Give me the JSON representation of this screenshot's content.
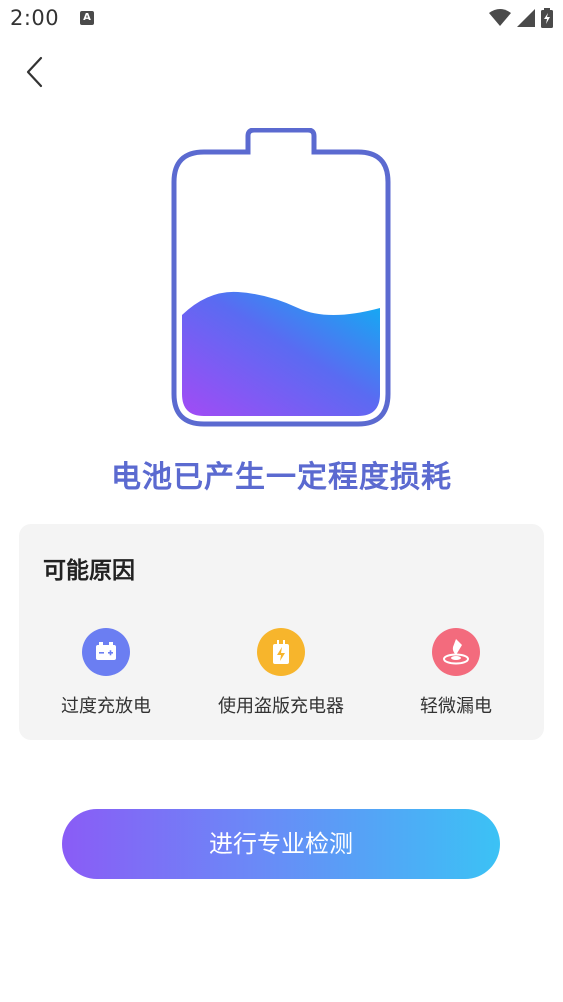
{
  "status_bar": {
    "time": "2:00",
    "notification_icon": "A",
    "icons": [
      "wifi-icon",
      "signal-icon",
      "battery-charging-icon"
    ]
  },
  "nav": {
    "back_icon": "chevron-left-icon"
  },
  "battery": {
    "fill_level": 0.42,
    "wave_colors": [
      "#a24bf5",
      "#5a6bf2",
      "#0bb2f3"
    ],
    "outline_color": "#5b6ad0"
  },
  "headline": "电池已产生一定程度损耗",
  "reasons": {
    "title": "可能原因",
    "items": [
      {
        "label": "过度充放电",
        "icon": "battery-icon",
        "color": "#6b7ef2"
      },
      {
        "label": "使用盗版充电器",
        "icon": "charger-icon",
        "color": "#f7b52c"
      },
      {
        "label": "轻微漏电",
        "icon": "leak-icon",
        "color": "#f36b7d"
      }
    ]
  },
  "action_button": {
    "label": "进行专业检测"
  }
}
